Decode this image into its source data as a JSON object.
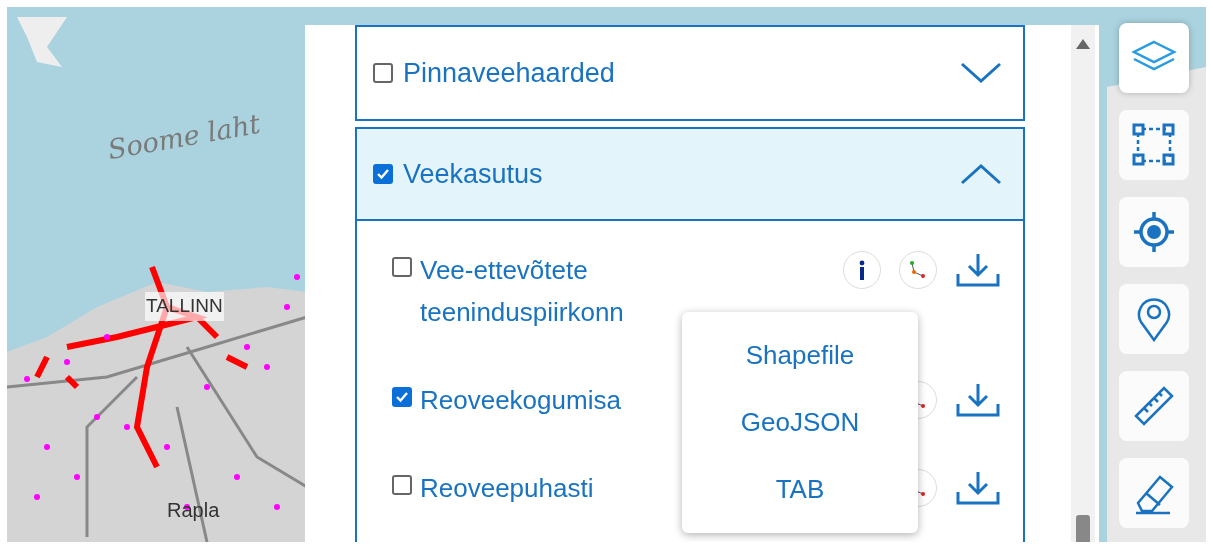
{
  "map": {
    "labels": [
      {
        "kind": "sea",
        "text": "Soome laht"
      },
      {
        "kind": "city",
        "text": "TALLINN"
      },
      {
        "kind": "town",
        "text": "Rapla"
      }
    ]
  },
  "layer_groups": [
    {
      "name": "Pinnaveehaarded",
      "checked": false,
      "expanded": false
    },
    {
      "name": "Veekasutus",
      "checked": true,
      "expanded": true,
      "layers": [
        {
          "name": "Vee-ettevõtete teeninduspiirkonn",
          "checked": false
        },
        {
          "name": "Reoveekogumisa",
          "checked": true
        },
        {
          "name": "Reoveepuhasti",
          "checked": false
        }
      ]
    }
  ],
  "download_menu": {
    "items": [
      "Shapefile",
      "GeoJSON",
      "TAB"
    ]
  },
  "toolbar": [
    {
      "kind": "layers",
      "selected": true
    },
    {
      "kind": "select-area",
      "selected": false
    },
    {
      "kind": "locate",
      "selected": false
    },
    {
      "kind": "pin",
      "selected": false
    },
    {
      "kind": "measure",
      "selected": false
    },
    {
      "kind": "erase",
      "selected": false
    }
  ]
}
